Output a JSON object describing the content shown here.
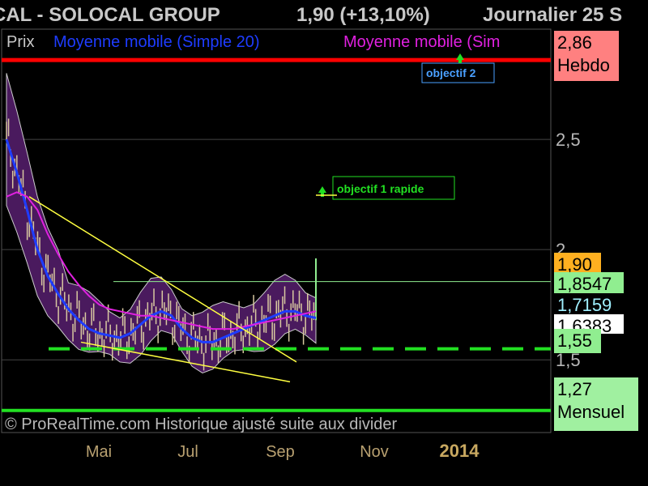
{
  "header": {
    "title": "CAL - SOLOCAL GROUP",
    "quote": "1,90 (+13,10%)",
    "period": "Journalier  25 S"
  },
  "legend": {
    "price": "Prix",
    "ma20": "Moyenne mobile (Simple 20)",
    "ma_other": "Moyenne mobile (Sim"
  },
  "footer": "© ProRealTime.com Historique ajusté suite aux divider",
  "colors": {
    "background": "#000000",
    "bollinger_fill": "#4a1a5e",
    "ma20": "#1e3cff",
    "ma_other": "#e020e0",
    "resistance": "#ff0000",
    "support_dashed": "#22e022",
    "support_solid": "#22e022",
    "trendline": "#ffff40",
    "objective_2": "#4aa0ff",
    "objective_1": "#22e022"
  },
  "chart_data": {
    "type": "line",
    "title": "CAL - SOLOCAL GROUP",
    "xlabel": "",
    "ylabel": "",
    "ylim": [
      1.17,
      3.0
    ],
    "yticks": [
      "2,5",
      "2",
      "1,5"
    ],
    "ytick_values": [
      2.5,
      2.0,
      1.5
    ],
    "xticks": [
      "Mai",
      "Jul",
      "Sep",
      "Nov",
      "2014"
    ],
    "grid": true,
    "legend_position": "top-left",
    "series": [
      {
        "name": "Moyenne mobile (Simple 20)",
        "values": [
          2.5,
          2.35,
          2.18,
          2.0,
          1.88,
          1.8,
          1.73,
          1.68,
          1.64,
          1.62,
          1.61,
          1.6,
          1.62,
          1.66,
          1.7,
          1.72,
          1.7,
          1.64,
          1.6,
          1.58,
          1.58,
          1.6,
          1.62,
          1.64,
          1.66,
          1.68,
          1.7,
          1.72,
          1.72,
          1.7,
          1.69
        ]
      },
      {
        "name": "Moyenne mobile (Sim",
        "values": [
          2.24,
          2.26,
          2.24,
          2.18,
          2.07,
          1.98,
          1.9,
          1.84,
          1.79,
          1.75,
          1.73,
          1.72,
          1.71,
          1.7,
          1.7,
          1.69,
          1.68,
          1.67,
          1.66,
          1.65,
          1.64,
          1.64,
          1.64,
          1.65,
          1.66,
          1.67,
          1.68,
          1.69,
          1.7,
          1.71,
          1.72
        ]
      }
    ],
    "levels": [
      {
        "label": "Hebdo",
        "value": 2.86
      },
      {
        "label": "objectif 2",
        "value": 2.86
      },
      {
        "label": "objectif 1 rapide",
        "value": 2.2
      },
      {
        "label": "",
        "value": 1.9
      },
      {
        "label": "",
        "value": 1.8547
      },
      {
        "label": "",
        "value": 1.7159
      },
      {
        "label": "",
        "value": 1.6383
      },
      {
        "label": "",
        "value": 1.55
      },
      {
        "label": "Mensuel",
        "value": 1.27
      }
    ],
    "price_tags": [
      {
        "text": "2,86",
        "sub": "Hebdo",
        "value": 2.86,
        "bg": "#ff8080"
      },
      {
        "text": "1,90",
        "sub": "",
        "value": 1.9,
        "bg": "#ffb020"
      },
      {
        "text": "1,8547",
        "sub": "",
        "value": 1.8547,
        "bg": "#90ee90"
      },
      {
        "text": "1,7159",
        "sub": "",
        "value": 1.7159,
        "bg": "#000000"
      },
      {
        "text": "1,6383",
        "sub": "",
        "value": 1.6383,
        "bg": "#ffffff"
      },
      {
        "text": "1,55",
        "sub": "",
        "value": 1.55,
        "bg": "#90ee90"
      },
      {
        "text": "1,27",
        "sub": "Mensuel",
        "value": 1.27,
        "bg": "#a0f0a0"
      }
    ],
    "annotations": [
      {
        "text": "objectif 2",
        "color": "#4aa0ff"
      },
      {
        "text": "objectif 1 rapide",
        "color": "#22e022"
      }
    ]
  }
}
